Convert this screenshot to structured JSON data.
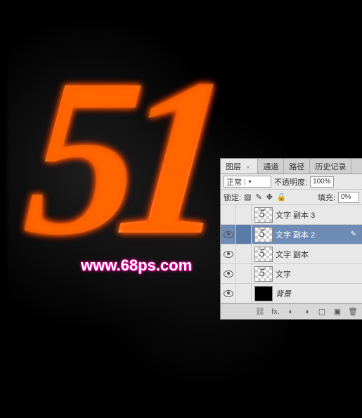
{
  "canvas": {
    "artwork_text": "51",
    "watermark": "www.68ps.com"
  },
  "panel": {
    "tabs": {
      "layers": "图层",
      "channels": "通道",
      "paths": "路径",
      "history": "历史记录"
    },
    "blend_mode": "正常",
    "opacity_label": "不透明度:",
    "opacity_value": "100%",
    "lock_label": "锁定:",
    "fill_label": "填充:",
    "fill_value": "0%",
    "layers": [
      {
        "visible": false,
        "name": "文字 副本 3",
        "selected": false,
        "thumb": "checker"
      },
      {
        "visible": true,
        "name": "文字 副本 2",
        "selected": true,
        "thumb": "checker"
      },
      {
        "visible": true,
        "name": "文字 副本",
        "selected": false,
        "thumb": "checker"
      },
      {
        "visible": true,
        "name": "文字",
        "selected": false,
        "thumb": "checker"
      },
      {
        "visible": true,
        "name": "背景",
        "selected": false,
        "thumb": "black"
      }
    ],
    "footer_icons": {
      "link": "⛓",
      "fx": "fx.",
      "mask": "◐",
      "adjust": "◑",
      "folder": "▢",
      "new": "▣",
      "trash": "🗑"
    }
  }
}
